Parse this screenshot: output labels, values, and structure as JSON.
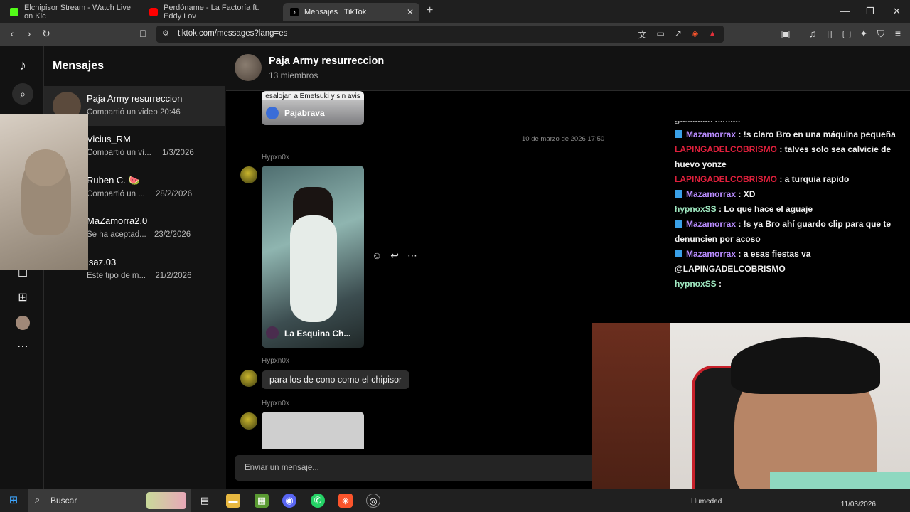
{
  "browser": {
    "tabs": [
      {
        "title": "Elchipisor Stream - Watch Live on Kic",
        "color": "#53fc18"
      },
      {
        "title": "Perdóname - La Factoría ft. Eddy Lov",
        "color": "#ff0000"
      },
      {
        "title": "Mensajes | TikTok",
        "color": "#000000"
      }
    ],
    "url": "tiktok.com/messages?lang=es"
  },
  "sidebar": {
    "title": "Mensajes",
    "conversations": [
      {
        "name": "Paja Army resurreccion",
        "preview": "Compartió un video",
        "time": "20:46"
      },
      {
        "name": "Vicius_RM",
        "preview": "Compartió un ví...",
        "time": "1/3/2026"
      },
      {
        "name": "Ruben C. 🍉",
        "preview": "Compartió un ...",
        "time": "28/2/2026"
      },
      {
        "name": "MaZamorra2.0",
        "preview": "Se ha aceptad...",
        "time": "23/2/2026"
      },
      {
        "name": "jsaz.03",
        "preview": "Este tipo de m...",
        "time": "21/2/2026"
      }
    ]
  },
  "chat": {
    "name": "Paja Army resurreccion",
    "members": "13 miembros",
    "timestamp": "10 de marzo de 2026 17:50",
    "video1": {
      "top_caption": "esalojan a Emetsuki y sin avis",
      "author": "Pajabrava"
    },
    "video2": {
      "sender": "Hypxn0x",
      "author": "La Esquina Ch..."
    },
    "message": {
      "sender": "Hypxn0x",
      "text": "para los de cono como el chipisor"
    },
    "video3": {
      "sender": "Hypxn0x"
    },
    "input_placeholder": "Enviar un mensaje..."
  },
  "stream_chat": [
    {
      "user": "",
      "text": "gustaban ninfas",
      "badge": false,
      "color": "#ffffff"
    },
    {
      "user": "Mazamorrax",
      "text": ": !s claro Bro en una máquina pequeña",
      "badge": true,
      "color": "#b98cff"
    },
    {
      "user": "LAPINGADELCOBRISMO",
      "text": ": talves solo sea calvicie de huevo yonze",
      "badge": false,
      "color": "#e0203c"
    },
    {
      "user": "LAPINGADELCOBRISMO",
      "text": ": a turquia rapido",
      "badge": false,
      "color": "#e0203c"
    },
    {
      "user": "Mazamorrax",
      "text": ": XD",
      "badge": true,
      "color": "#b98cff"
    },
    {
      "user": "hypnoxSS",
      "text": ": Lo que hace el aguaje",
      "badge": false,
      "color": "#9fe8c0"
    },
    {
      "user": "Mazamorrax",
      "text": ": !s ya Bro ahí guardo clip para que te denuncien por acoso",
      "badge": true,
      "color": "#b98cff"
    },
    {
      "user": "Mazamorrax",
      "text": ": a esas fiestas va @LAPINGADELCOBRISMO",
      "badge": true,
      "color": "#b98cff"
    },
    {
      "user": "hypnoxSS",
      "text": ":",
      "badge": false,
      "color": "#9fe8c0"
    }
  ],
  "taskbar": {
    "search": "Buscar",
    "weather": "Humedad",
    "date": "11/03/2026"
  }
}
